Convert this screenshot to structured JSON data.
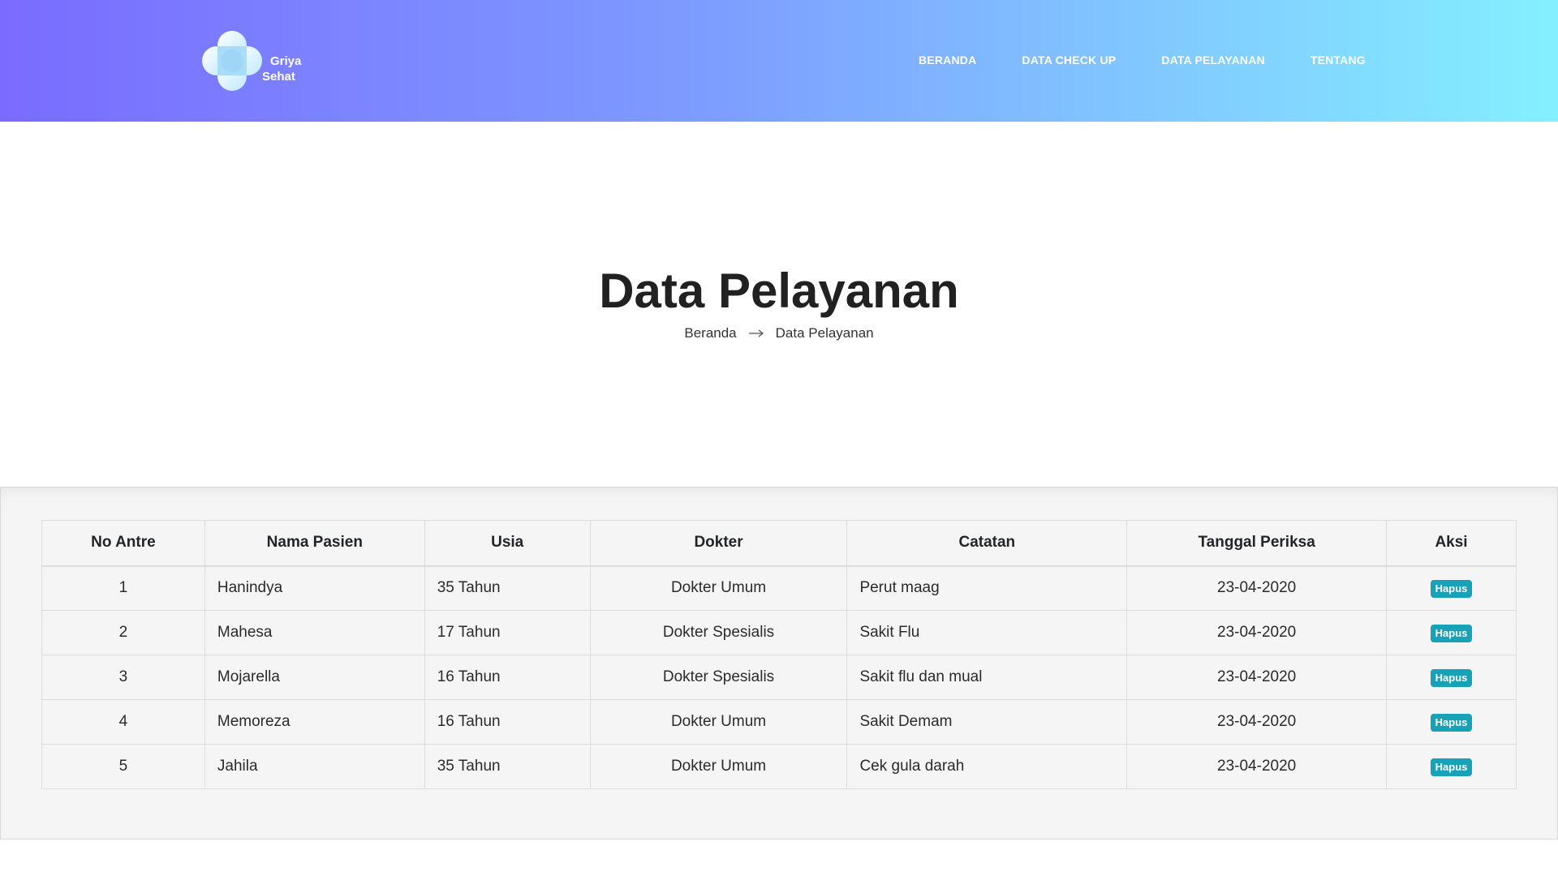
{
  "brand": {
    "line1": "Griya",
    "line2": "Sehat",
    "logo_icon": "medical-cross-logo-icon"
  },
  "nav": {
    "items": [
      {
        "label": "BERANDA"
      },
      {
        "label": "DATA CHECK UP"
      },
      {
        "label": "DATA PELAYANAN"
      },
      {
        "label": "TENTANG"
      }
    ]
  },
  "hero": {
    "title": "Data Pelayanan",
    "breadcrumb": {
      "home": "Beranda",
      "separator_icon": "arrow-right-icon",
      "current": "Data Pelayanan"
    }
  },
  "table": {
    "headers": [
      "No Antre",
      "Nama Pasien",
      "Usia",
      "Dokter",
      "Catatan",
      "Tanggal Periksa",
      "Aksi"
    ],
    "rows": [
      {
        "no": "1",
        "nama": "Hanindya",
        "usia": "35 Tahun",
        "dokter": "Dokter Umum",
        "catatan": "Perut maag",
        "tanggal": "23-04-2020",
        "aksi": "Hapus"
      },
      {
        "no": "2",
        "nama": "Mahesa",
        "usia": "17 Tahun",
        "dokter": "Dokter Spesialis",
        "catatan": "Sakit Flu",
        "tanggal": "23-04-2020",
        "aksi": "Hapus"
      },
      {
        "no": "3",
        "nama": "Mojarella",
        "usia": "16 Tahun",
        "dokter": "Dokter Spesialis",
        "catatan": "Sakit flu dan mual",
        "tanggal": "23-04-2020",
        "aksi": "Hapus"
      },
      {
        "no": "4",
        "nama": "Memoreza",
        "usia": "16 Tahun",
        "dokter": "Dokter Umum",
        "catatan": "Sakit Demam",
        "tanggal": "23-04-2020",
        "aksi": "Hapus"
      },
      {
        "no": "5",
        "nama": "Jahila",
        "usia": "35 Tahun",
        "dokter": "Dokter Umum",
        "catatan": "Cek gula darah",
        "tanggal": "23-04-2020",
        "aksi": "Hapus"
      }
    ]
  },
  "colors": {
    "header_gradient_start": "#7a6cff",
    "header_gradient_mid": "#7d9cff",
    "header_gradient_end": "#84f0ff",
    "button_hapus": "#17a2b8",
    "panel_bg": "#f5f5f5"
  }
}
